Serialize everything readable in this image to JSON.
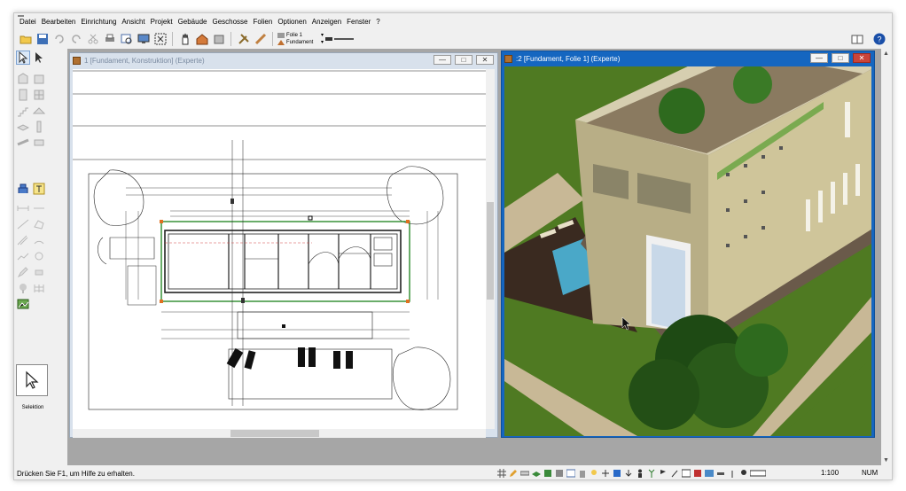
{
  "menu": [
    "Datei",
    "Bearbeiten",
    "Einrichtung",
    "Ansicht",
    "Projekt",
    "Gebäude",
    "Geschosse",
    "Folien",
    "Optionen",
    "Anzeigen",
    "Fenster",
    "?"
  ],
  "toolbar": {
    "layer_value": "Folie 1",
    "floor_value": "Fundament"
  },
  "left_panel": {
    "selection_label": "Selektion"
  },
  "window_plan": {
    "title": "1 [Fundament, Konstruktion] (Experte)"
  },
  "window_3d": {
    "title": ":2 [Fundament, Folie 1] (Experte)"
  },
  "window_buttons": {
    "min": "—",
    "max": "□",
    "close": "✕"
  },
  "status": {
    "help_text": "Drücken Sie F1, um Hilfe zu erhalten.",
    "scale": "1:100",
    "num": "NUM"
  },
  "colors": {
    "active_title": "#1566c0",
    "inactive_title": "#d8e1ec",
    "grass": "#4f7a22",
    "building": "#b8ae86"
  }
}
